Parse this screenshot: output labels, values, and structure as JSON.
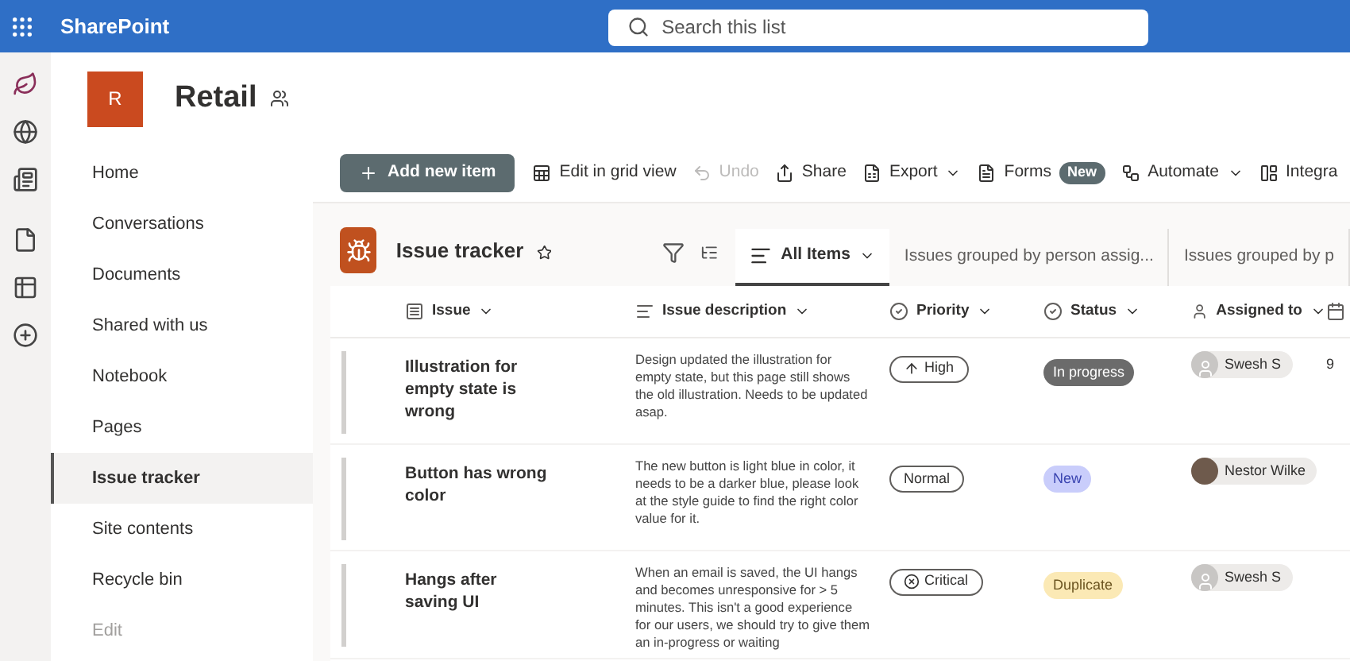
{
  "top_bar": {
    "app_name": "SharePoint",
    "search": {
      "placeholder": "Search this list"
    }
  },
  "site": {
    "logo_letter": "R",
    "title": "Retail"
  },
  "nav": [
    {
      "label": "Home",
      "selected": false,
      "disabled": false
    },
    {
      "label": "Conversations",
      "selected": false,
      "disabled": false
    },
    {
      "label": "Documents",
      "selected": false,
      "disabled": false
    },
    {
      "label": "Shared with us",
      "selected": false,
      "disabled": false
    },
    {
      "label": "Notebook",
      "selected": false,
      "disabled": false
    },
    {
      "label": "Pages",
      "selected": false,
      "disabled": false
    },
    {
      "label": "Issue tracker",
      "selected": true,
      "disabled": false
    },
    {
      "label": "Site contents",
      "selected": false,
      "disabled": false
    },
    {
      "label": "Recycle bin",
      "selected": false,
      "disabled": false
    },
    {
      "label": "Edit",
      "selected": false,
      "disabled": true
    }
  ],
  "command_bar": [
    {
      "kind": "primary",
      "label": "Add new item",
      "disabled": false
    },
    {
      "kind": "grid",
      "label": "Edit in grid view",
      "disabled": false
    },
    {
      "kind": "undo",
      "label": "Undo",
      "disabled": true
    },
    {
      "kind": "share",
      "label": "Share",
      "disabled": false
    },
    {
      "kind": "export",
      "label": "Export",
      "disabled": false,
      "dropdown": true
    },
    {
      "kind": "forms",
      "label": "Forms",
      "disabled": false,
      "badge": "New"
    },
    {
      "kind": "automate",
      "label": "Automate",
      "disabled": false,
      "dropdown": true
    },
    {
      "kind": "integrate",
      "label": "Integra",
      "disabled": false
    }
  ],
  "list": {
    "title": "Issue tracker",
    "favorite": false,
    "views": [
      {
        "label": "All Items",
        "selected": true
      },
      {
        "label": "Issues grouped by person assig...",
        "selected": false
      },
      {
        "label": "Issues grouped by p",
        "selected": false
      }
    ]
  },
  "table": {
    "columns": [
      {
        "kind": "title",
        "label": "Issue"
      },
      {
        "kind": "text",
        "label": "Issue description"
      },
      {
        "kind": "choice",
        "label": "Priority"
      },
      {
        "kind": "choice",
        "label": "Status"
      },
      {
        "kind": "person",
        "label": "Assigned to"
      },
      {
        "kind": "date"
      }
    ],
    "rows": [
      {
        "issue": "Illustration for empty state is wrong",
        "description": "Design updated the illustration for empty state, but this page still shows the old illustration. Needs to be updated asap.",
        "priority": {
          "kind": "high",
          "label": "High"
        },
        "status": {
          "kind": "progress",
          "label": "In progress"
        },
        "assigned": {
          "kind": "generic",
          "name": "Swesh S"
        },
        "column_6": "9"
      },
      {
        "issue": "Button has wrong color",
        "description": "The new button is light blue in color, it needs to be a darker blue, please look at the style guide to find the right color value for it.",
        "priority": {
          "kind": "normal",
          "label": "Normal"
        },
        "status": {
          "kind": "new",
          "label": "New"
        },
        "assigned": {
          "kind": "photo",
          "name": "Nestor Wilke"
        }
      },
      {
        "issue": "Hangs after saving UI",
        "description": "When an email is saved, the UI hangs and becomes unresponsive for > 5 minutes. This isn't a good experience for our users, we should try to give them an in-progress or waiting",
        "priority": {
          "kind": "critical",
          "label": "Critical"
        },
        "status": {
          "kind": "duplicate",
          "label": "Duplicate"
        },
        "assigned": {
          "kind": "generic",
          "name": "Swesh S"
        }
      }
    ]
  }
}
